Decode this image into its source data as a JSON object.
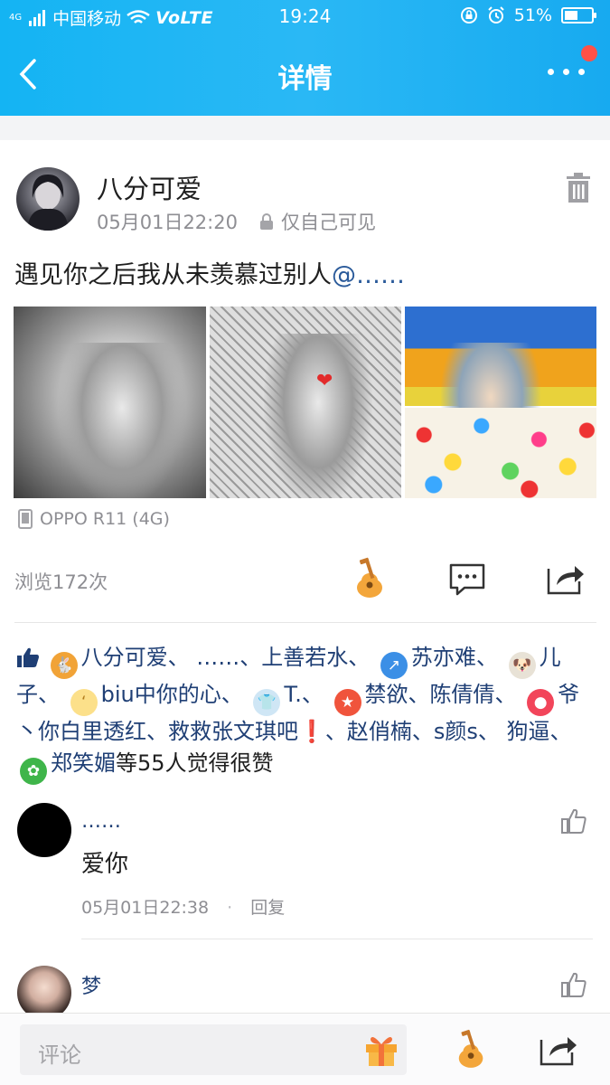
{
  "status_bar": {
    "network_small": "4G",
    "carrier": "中国移动",
    "volte": "VoLTE",
    "time": "19:24",
    "battery": "51%",
    "battery_level": 0.51
  },
  "nav": {
    "title": "详情"
  },
  "post": {
    "username": "八分可爱",
    "timestamp": "05月01日22:20",
    "privacy": "仅自己可见",
    "text": "遇见你之后我从未羡慕过别人",
    "mention": "@……",
    "device": "OPPO R11 (4G)",
    "views": "浏览172次"
  },
  "likes": {
    "names": [
      "八分可爱、",
      "……、",
      "上善若水、",
      "苏亦难、",
      "儿子、",
      "biu中你的心、",
      "T.、",
      "禁欲、",
      "陈倩倩、",
      "爷丶你白里透红、",
      "救救张文琪吧",
      "❗",
      "、赵俏楠、",
      "s颜s、",
      "狗逼、",
      "郑笑媚"
    ],
    "suffix": "等55人觉得很赞"
  },
  "comments": [
    {
      "name": "……",
      "text": "爱你",
      "time": "05月01日22:38",
      "reply": "回复"
    },
    {
      "name": "梦"
    }
  ],
  "bottom": {
    "placeholder": "评论"
  },
  "colors": {
    "accent": "#17AEF2",
    "link": "#1F3F75",
    "badge": "#FF5147"
  },
  "icons": [
    "back-arrow-icon",
    "more-dots-icon",
    "trash-icon",
    "lock-icon",
    "phone-icon",
    "guitar-icon",
    "comment-icon",
    "share-icon",
    "thumbs-up-icon",
    "gift-icon"
  ]
}
